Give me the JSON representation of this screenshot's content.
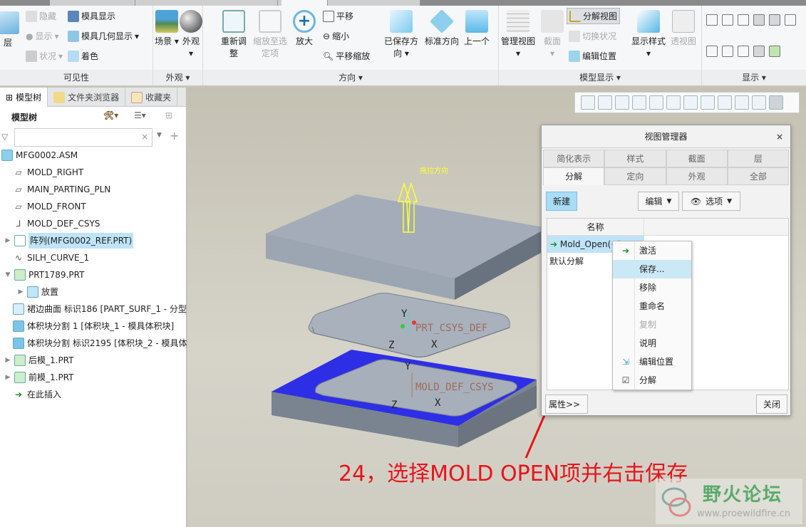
{
  "ribbon": {
    "visibility": {
      "layer": "层",
      "hide": "隐藏",
      "show": "显示",
      "status": "状况",
      "mold_display": "模具显示",
      "mold_geom_display": "模具几何显示",
      "shade": "着色",
      "label": "可见性"
    },
    "appearance": {
      "scene": "场景",
      "appearance": "外观",
      "label": "外观"
    },
    "orientation": {
      "refit": "重新调整",
      "zoom_selected": "缩放至选定项",
      "zoom_in": "放大",
      "pan": "平移",
      "zoom_out": "缩小",
      "pan_zoom": "平移缩放",
      "saved_orient": "已保存方向",
      "std_orient": "标准方向",
      "previous": "上一个",
      "label": "方向"
    },
    "model_display": {
      "manage_views": "管理视图",
      "section": "截面",
      "explode_view": "分解视图",
      "toggle_status": "切换状况",
      "edit_position": "编辑位置",
      "display_style": "显示样式",
      "perspective": "透视图",
      "label": "模型显示"
    },
    "display": {
      "label": "显示"
    }
  },
  "panel": {
    "tabs": [
      "模型树",
      "文件夹浏览器",
      "收藏夹"
    ],
    "header": "模型树",
    "filter_placeholder": "",
    "tree": [
      {
        "label": "MFG0002.ASM",
        "icon": "assembly-icon"
      },
      {
        "label": "MOLD_RIGHT",
        "icon": "datum-plane-icon"
      },
      {
        "label": "MAIN_PARTING_PLN",
        "icon": "datum-plane-icon"
      },
      {
        "label": "MOLD_FRONT",
        "icon": "datum-plane-icon"
      },
      {
        "label": "MOLD_DEF_CSYS",
        "icon": "csys-icon"
      },
      {
        "label": "阵列(MFG0002_REF.PRT)",
        "icon": "pattern-icon",
        "selected": true
      },
      {
        "label": "SILH_CURVE_1",
        "icon": "curve-icon"
      },
      {
        "label": "PRT1789.PRT",
        "icon": "part-icon"
      },
      {
        "label": "放置",
        "icon": "placement-icon"
      },
      {
        "label": "裙边曲面 标识186 [PART_SURF_1 - 分型",
        "icon": "surface-icon"
      },
      {
        "label": "体积块分割 1 [体积块_1 - 模具体积块]",
        "icon": "volume-split-icon"
      },
      {
        "label": "体积块分割 标识2195 [体积块_2 - 模具体",
        "icon": "volume-split-icon"
      },
      {
        "label": "后模_1.PRT",
        "icon": "part-icon"
      },
      {
        "label": "前模_1.PRT",
        "icon": "part-icon"
      },
      {
        "label": "在此插入",
        "icon": "insert-here-icon"
      }
    ]
  },
  "viewport": {
    "pull_direction": "拖拉方向",
    "csys1": "PRT_CSYS_DEF",
    "csys2": "MOLD_DEF_CSYS",
    "axes": [
      "X",
      "Y",
      "Z"
    ],
    "surface_color": "#2e2ee6",
    "model_color": "#9aa3ae"
  },
  "dialog": {
    "title": "视图管理器",
    "tabs_row1": [
      "简化表示",
      "样式",
      "截面",
      "层"
    ],
    "tabs_row2": [
      "分解",
      "定向",
      "外观",
      "全部"
    ],
    "new": "新建",
    "edit": "编辑",
    "options": "选项",
    "col_name": "名称",
    "items": [
      "Mold_Open(+)",
      "默认分解"
    ],
    "properties": "属性>>",
    "close": "关闭"
  },
  "context_menu": [
    {
      "label": "激活"
    },
    {
      "label": "保存..."
    },
    {
      "label": "移除"
    },
    {
      "label": "重命名"
    },
    {
      "label": "复制",
      "disabled": true
    },
    {
      "label": "说明"
    },
    {
      "label": "编辑位置"
    },
    {
      "label": "分解",
      "checked": true
    }
  ],
  "annotation": "24，选择MOLD OPEN项并右击保存",
  "watermark": {
    "name": "野火论坛",
    "url": "www.proewildfire.cn"
  }
}
